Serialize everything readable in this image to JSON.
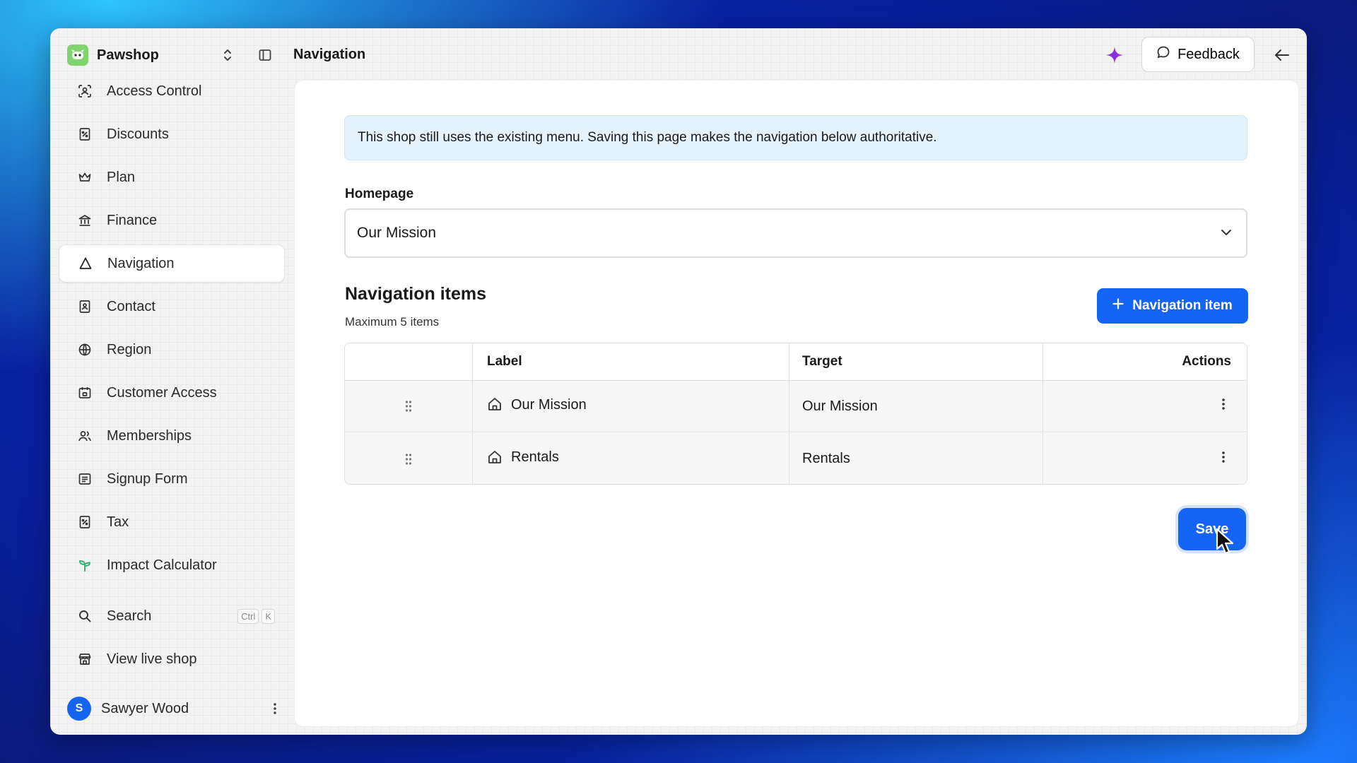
{
  "app": {
    "name": "Pawshop",
    "page_title": "Navigation",
    "feedback_label": "Feedback"
  },
  "sidebar": {
    "items": [
      {
        "label": "Access Control",
        "icon": "scan-face-icon"
      },
      {
        "label": "Discounts",
        "icon": "percent-receipt-icon"
      },
      {
        "label": "Plan",
        "icon": "crown-icon"
      },
      {
        "label": "Finance",
        "icon": "bank-icon"
      },
      {
        "label": "Navigation",
        "icon": "triangle-icon",
        "active": true
      },
      {
        "label": "Contact",
        "icon": "contact-book-icon"
      },
      {
        "label": "Region",
        "icon": "globe-icon"
      },
      {
        "label": "Customer Access",
        "icon": "calendar-lock-icon"
      },
      {
        "label": "Memberships",
        "icon": "users-icon"
      },
      {
        "label": "Signup Form",
        "icon": "form-icon"
      },
      {
        "label": "Tax",
        "icon": "percent-receipt-icon"
      },
      {
        "label": "Impact Calculator",
        "icon": "sprout-icon"
      }
    ],
    "search_label": "Search",
    "search_kbd": [
      "Ctrl",
      "K"
    ],
    "live_shop_label": "View live shop",
    "user": {
      "name": "Sawyer Wood",
      "initial": "S"
    }
  },
  "main": {
    "banner": "This shop still uses the existing menu. Saving this page makes the navigation below authoritative.",
    "homepage_label": "Homepage",
    "homepage_value": "Our Mission",
    "section_title": "Navigation items",
    "section_sub": "Maximum 5 items",
    "add_button_label": "Navigation item",
    "table": {
      "columns": [
        "Label",
        "Target",
        "Actions"
      ],
      "rows": [
        {
          "label": "Our Mission",
          "target": "Our Mission"
        },
        {
          "label": "Rentals",
          "target": "Rentals"
        }
      ]
    },
    "save_label": "Save"
  },
  "colors": {
    "accent": "#1565f5",
    "banner_bg": "#e3f2fd",
    "brand_logo": "#7fd46b",
    "ai_sparkle": "#8e2de2"
  }
}
